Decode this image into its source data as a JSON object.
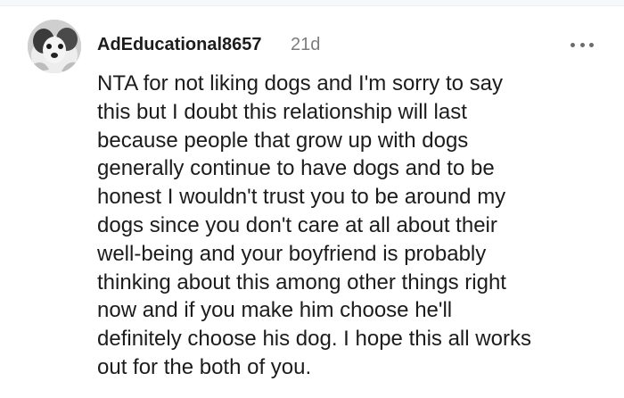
{
  "comment": {
    "username": "AdEducational8657",
    "timestamp": "21d",
    "more_icon": "more-horizontal-icon",
    "avatar_icon": "dog-avatar-icon",
    "body_lines": [
      "NTA for not liking dogs and I'm sorry to say",
      "this but I doubt this relationship will last",
      "because people that grow up with dogs",
      "generally continue to have dogs and to be",
      "honest I wouldn't trust you to be around my",
      "dogs since you don't care at all about their",
      "well-being and your boyfriend is probably",
      "thinking about this among other things right",
      "now and if you make him choose he'll",
      "definitely choose his dog. I hope this all works",
      "out for the both of you."
    ]
  },
  "colors": {
    "text": "#1c1c1c",
    "meta": "#7c7c7c",
    "icon": "#6a6c6e"
  }
}
